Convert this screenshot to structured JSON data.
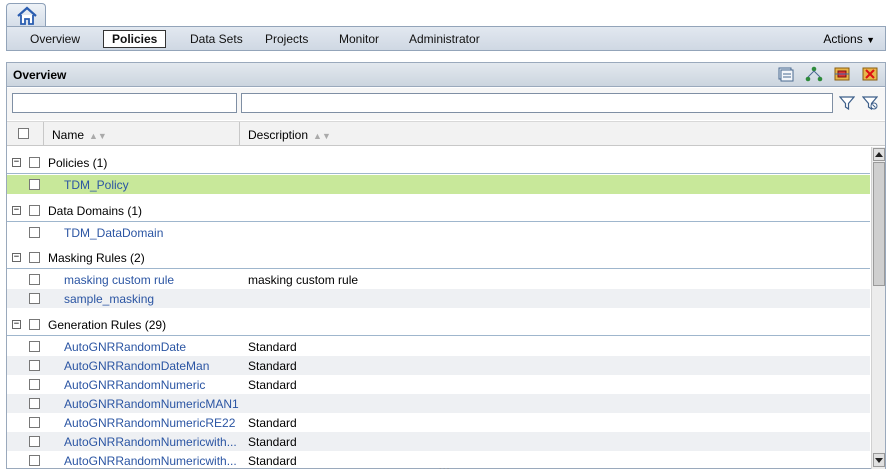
{
  "home": {
    "icon": "home-icon"
  },
  "nav": {
    "items": [
      {
        "label": "Overview"
      },
      {
        "label": "Policies"
      },
      {
        "label": "Data Sets"
      },
      {
        "label": "Projects"
      },
      {
        "label": "Monitor"
      },
      {
        "label": "Administrator"
      }
    ],
    "active": "Policies",
    "actions_label": "Actions"
  },
  "panel": {
    "title": "Overview",
    "toolbar_icons": [
      "new-policy-icon",
      "hierarchy-icon",
      "import-icon",
      "delete-icon"
    ],
    "filter_icons": [
      "filter-icon",
      "clear-filter-icon"
    ]
  },
  "grid": {
    "columns": [
      {
        "label": "Name"
      },
      {
        "label": "Description"
      }
    ],
    "groups": [
      {
        "label": "Policies (1)",
        "items": [
          {
            "name": "TDM_Policy",
            "description": ""
          }
        ]
      },
      {
        "label": "Data Domains (1)",
        "items": [
          {
            "name": "TDM_DataDomain",
            "description": ""
          }
        ]
      },
      {
        "label": "Masking Rules (2)",
        "items": [
          {
            "name": "masking custom rule",
            "description": "masking custom rule"
          },
          {
            "name": "sample_masking",
            "description": ""
          }
        ]
      },
      {
        "label": "Generation Rules (29)",
        "items": [
          {
            "name": "AutoGNRRandomDate",
            "description": "Standard"
          },
          {
            "name": "AutoGNRRandomDateMan",
            "description": "Standard"
          },
          {
            "name": "AutoGNRRandomNumeric",
            "description": "Standard"
          },
          {
            "name": "AutoGNRRandomNumericMAN1",
            "description": ""
          },
          {
            "name": "AutoGNRRandomNumericRE22",
            "description": "Standard"
          },
          {
            "name": "AutoGNRRandomNumericwith...",
            "description": "Standard"
          },
          {
            "name": "AutoGNRRandomNumericwith...",
            "description": "Standard"
          }
        ]
      }
    ]
  },
  "colors": {
    "selected_row": "#c8e89a",
    "link": "#2b55a3",
    "nav_bg": "#d8e0ea"
  }
}
